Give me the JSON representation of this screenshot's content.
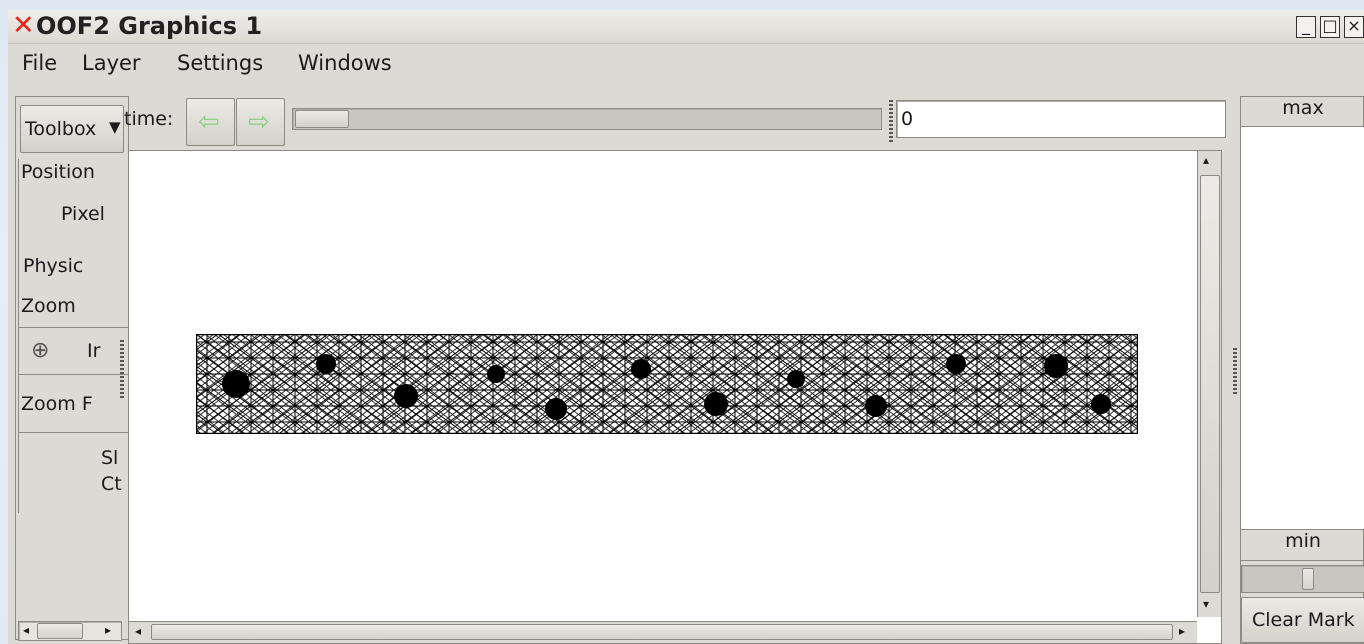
{
  "window": {
    "title": "OOF2 Graphics 1"
  },
  "menu": [
    "File",
    "Layer",
    "Settings",
    "Windows"
  ],
  "toolbox": {
    "selector_label": "Toolbox",
    "position_group": "Position",
    "pixel_label": "Pixel",
    "physical_label": "Physic",
    "zoom_group": "Zoom",
    "zoom_in_label": "Ir",
    "zoom_factor_label": "Zoom F",
    "shift_label": "Sl",
    "ctrl_label": "Ct"
  },
  "time": {
    "label": "time:",
    "value": "0",
    "slider_fraction": 0.0
  },
  "contour": {
    "max_label": "max",
    "min_label": "min",
    "clear_button": "Clear Mark"
  },
  "colors": {
    "close_x": "#e8231a",
    "background": "#dcdad5",
    "canvas": "#ffffff",
    "mesh": "#000000"
  },
  "icons": [
    "close-icon",
    "minimize-icon",
    "maximize-icon",
    "back-arrow-icon",
    "forward-arrow-icon",
    "zoom-in-icon",
    "dropdown-arrow-icon",
    "scroll-up-icon",
    "scroll-down-icon",
    "scroll-left-icon",
    "scroll-right-icon"
  ]
}
